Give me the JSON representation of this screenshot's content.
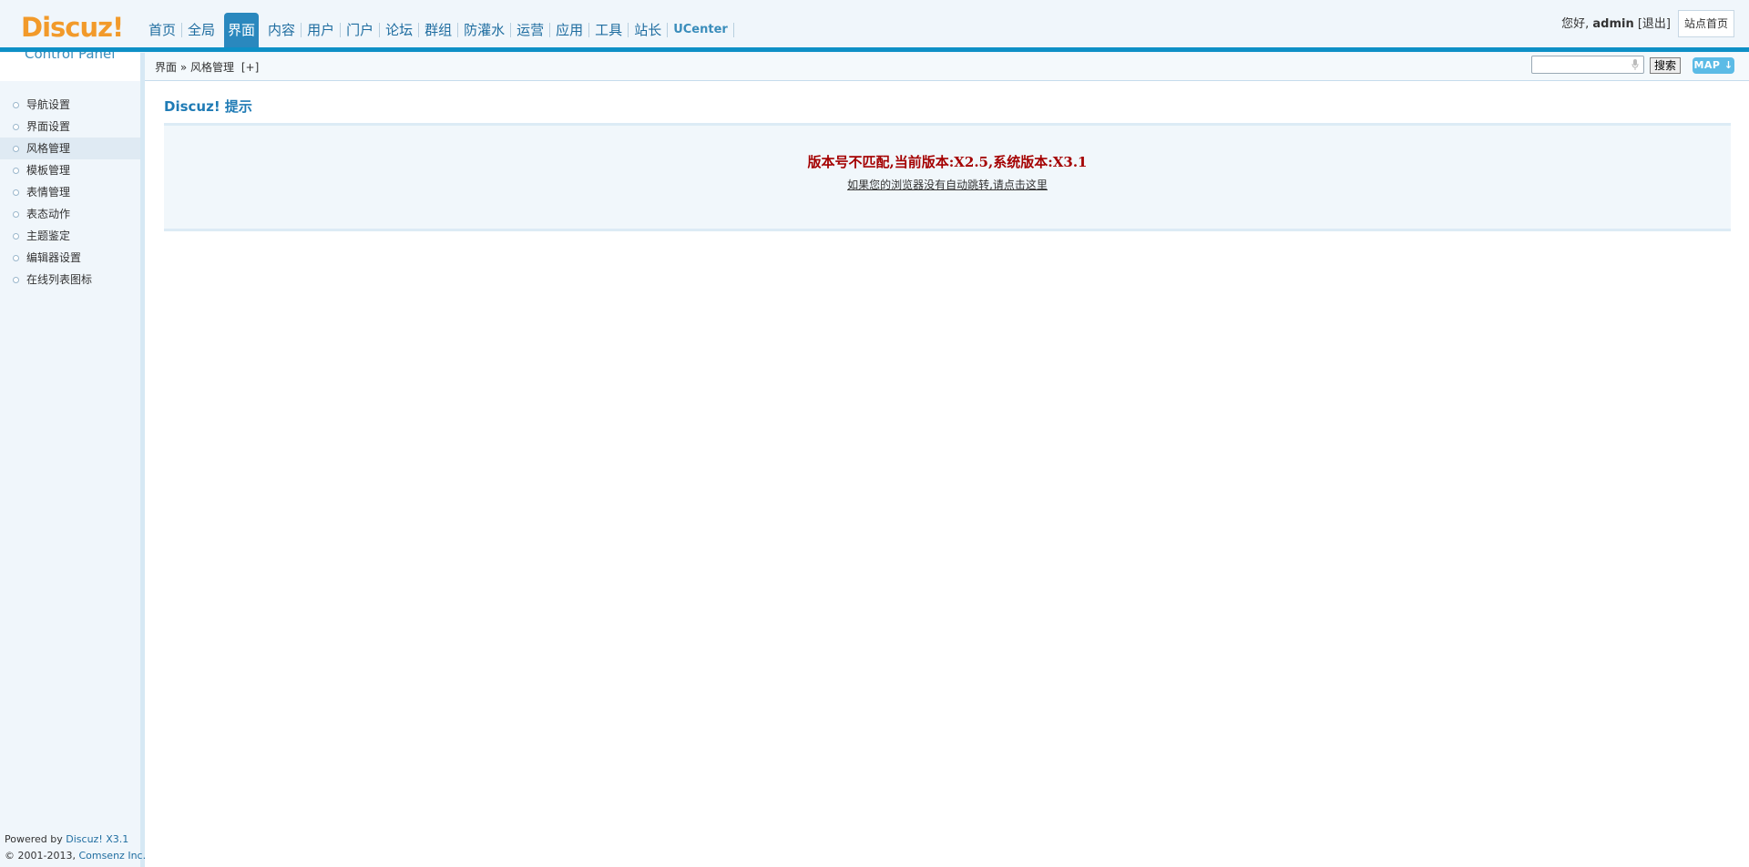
{
  "logo": {
    "brand": "Discuz!",
    "subtitle": "Control Panel"
  },
  "nav": {
    "items": [
      {
        "label": "首页"
      },
      {
        "label": "全局"
      },
      {
        "label": "界面",
        "active": true
      },
      {
        "label": "内容"
      },
      {
        "label": "用户"
      },
      {
        "label": "门户"
      },
      {
        "label": "论坛"
      },
      {
        "label": "群组"
      },
      {
        "label": "防灌水"
      },
      {
        "label": "运营"
      },
      {
        "label": "应用"
      },
      {
        "label": "工具"
      },
      {
        "label": "站长"
      },
      {
        "label": "UCenter"
      }
    ]
  },
  "user": {
    "greeting": "您好,",
    "name": "admin",
    "logout": "[退出]",
    "site_home": "站点首页"
  },
  "breadcrumb": {
    "section": "界面",
    "separator": "»",
    "page": "风格管理",
    "add": "[+]"
  },
  "search": {
    "placeholder": "",
    "button": "搜索",
    "map_button": "MAP"
  },
  "sidebar": {
    "items": [
      {
        "label": "导航设置"
      },
      {
        "label": "界面设置"
      },
      {
        "label": "风格管理",
        "active": true
      },
      {
        "label": "模板管理"
      },
      {
        "label": "表情管理"
      },
      {
        "label": "表态动作"
      },
      {
        "label": "主题鉴定"
      },
      {
        "label": "编辑器设置"
      },
      {
        "label": "在线列表图标"
      }
    ]
  },
  "footer": {
    "powered_prefix": "Powered by ",
    "powered_link": "Discuz! X3.1",
    "copyright_prefix": "© 2001-2013, ",
    "copyright_link": "Comsenz Inc."
  },
  "main": {
    "title": "Discuz! 提示",
    "message": "版本号不匹配,当前版本:X2.5,系统版本:X3.1",
    "redirect_link": "如果您的浏览器没有自动跳转,请点击这里"
  },
  "colors": {
    "accent": "#0e90c6",
    "nav_active": "#2a88be",
    "error": "#a40000",
    "logo": "#f29a2a"
  }
}
